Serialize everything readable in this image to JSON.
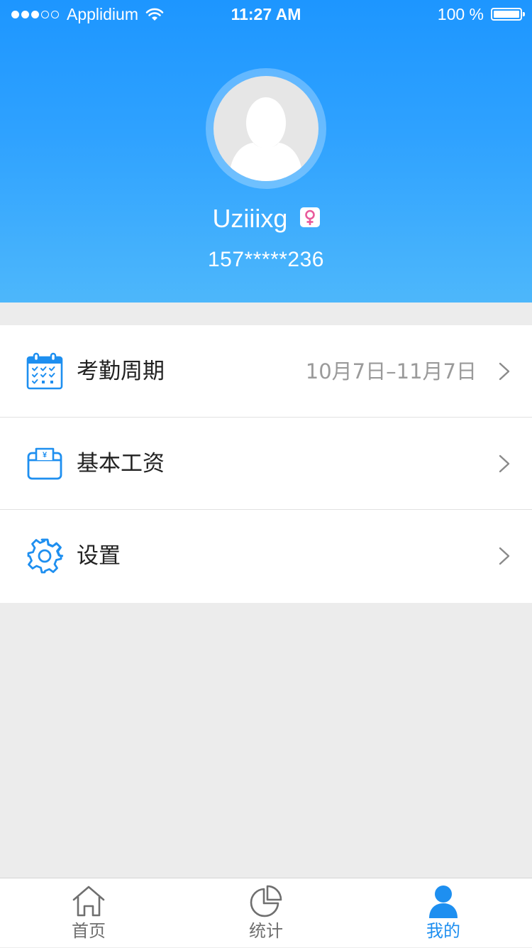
{
  "status_bar": {
    "carrier": "Applidium",
    "time": "11:27 AM",
    "battery": "100 %"
  },
  "profile": {
    "username": "Uziiixg",
    "gender": "female",
    "phone": "157*****236"
  },
  "menu": {
    "items": [
      {
        "label": "考勤周期",
        "value": "10月7日–11月7日",
        "icon": "calendar-icon"
      },
      {
        "label": "基本工资",
        "value": "",
        "icon": "wallet-icon"
      },
      {
        "label": "设置",
        "value": "",
        "icon": "gear-icon"
      }
    ]
  },
  "tabbar": {
    "tabs": [
      {
        "label": "首页",
        "icon": "home-icon",
        "active": false
      },
      {
        "label": "统计",
        "icon": "pie-chart-icon",
        "active": false
      },
      {
        "label": "我的",
        "icon": "person-icon",
        "active": true
      }
    ]
  },
  "colors": {
    "accent": "#1e8ff0",
    "header_top": "#1d96ff",
    "header_bottom": "#4db7fb",
    "female_badge": "#e8599b",
    "background": "#ececec"
  }
}
